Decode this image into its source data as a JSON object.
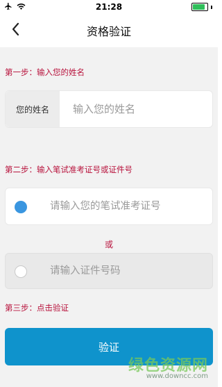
{
  "status_bar": {
    "time": "21:28",
    "icons": [
      "airplane-icon",
      "wifi-icon",
      "battery-icon"
    ]
  },
  "nav": {
    "title": "资格验证",
    "back_icon": "chevron-left-icon"
  },
  "step1": {
    "label": "第一步：输入您的姓名",
    "field_label": "您的姓名",
    "placeholder": "输入您的姓名"
  },
  "step2": {
    "label": "第二步：输入笔试准考证号或证件号",
    "option1_placeholder": "请输入您的笔试准考证号",
    "or_text": "或",
    "option2_placeholder": "请输入证件号码",
    "option1_selected": true
  },
  "step3": {
    "label": "第三步：点击验证",
    "button_label": "验证"
  },
  "watermark": {
    "title": "绿色资源网",
    "url": "www.downcc.com"
  },
  "colors": {
    "accent": "#0f93cc",
    "step_text": "#b8123c",
    "radio_on": "#3a96e0",
    "background": "#f2f2f2"
  }
}
